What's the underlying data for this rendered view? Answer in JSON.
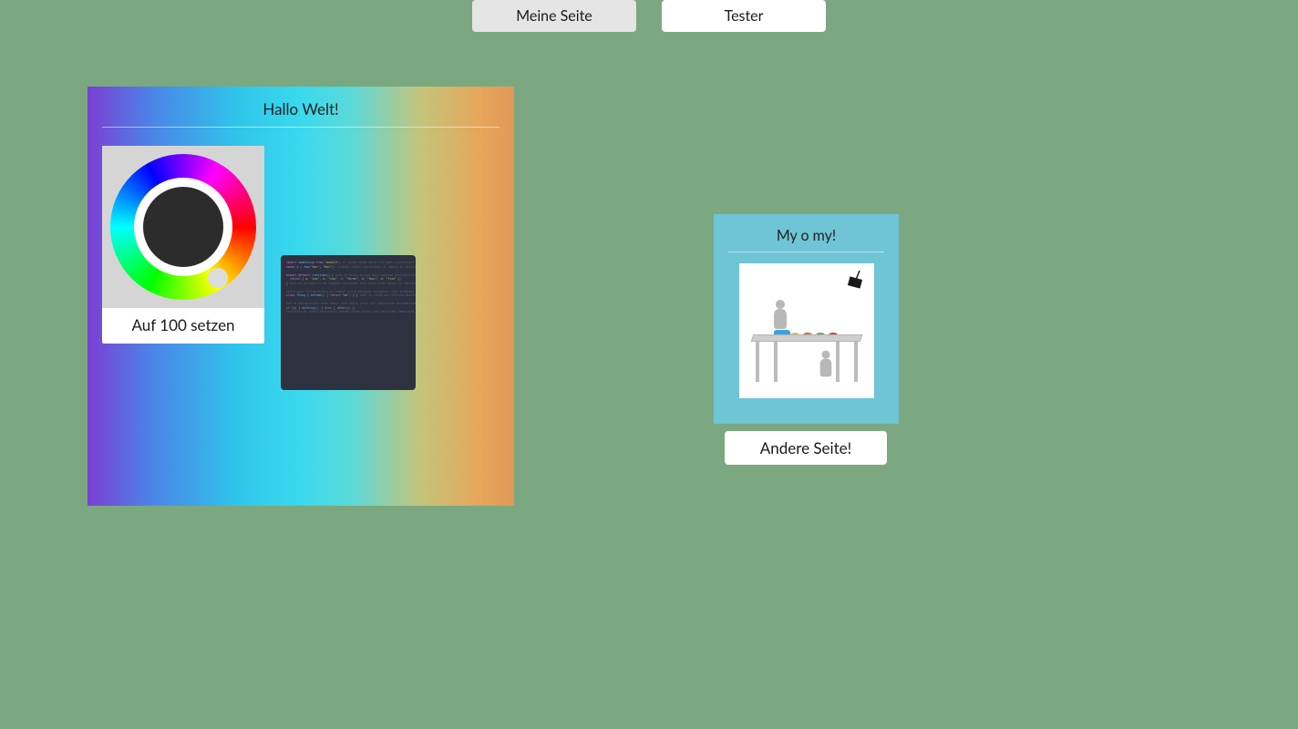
{
  "tabs": {
    "items": [
      {
        "label": "Meine Seite",
        "active": true
      },
      {
        "label": "Tester",
        "active": false
      }
    ]
  },
  "left_panel": {
    "title": "Hallo Welt!",
    "color_card_label": "Auf 100 setzen"
  },
  "right_panel": {
    "title": "My o my!"
  },
  "andere_button": {
    "label": "Andere Seite!"
  }
}
